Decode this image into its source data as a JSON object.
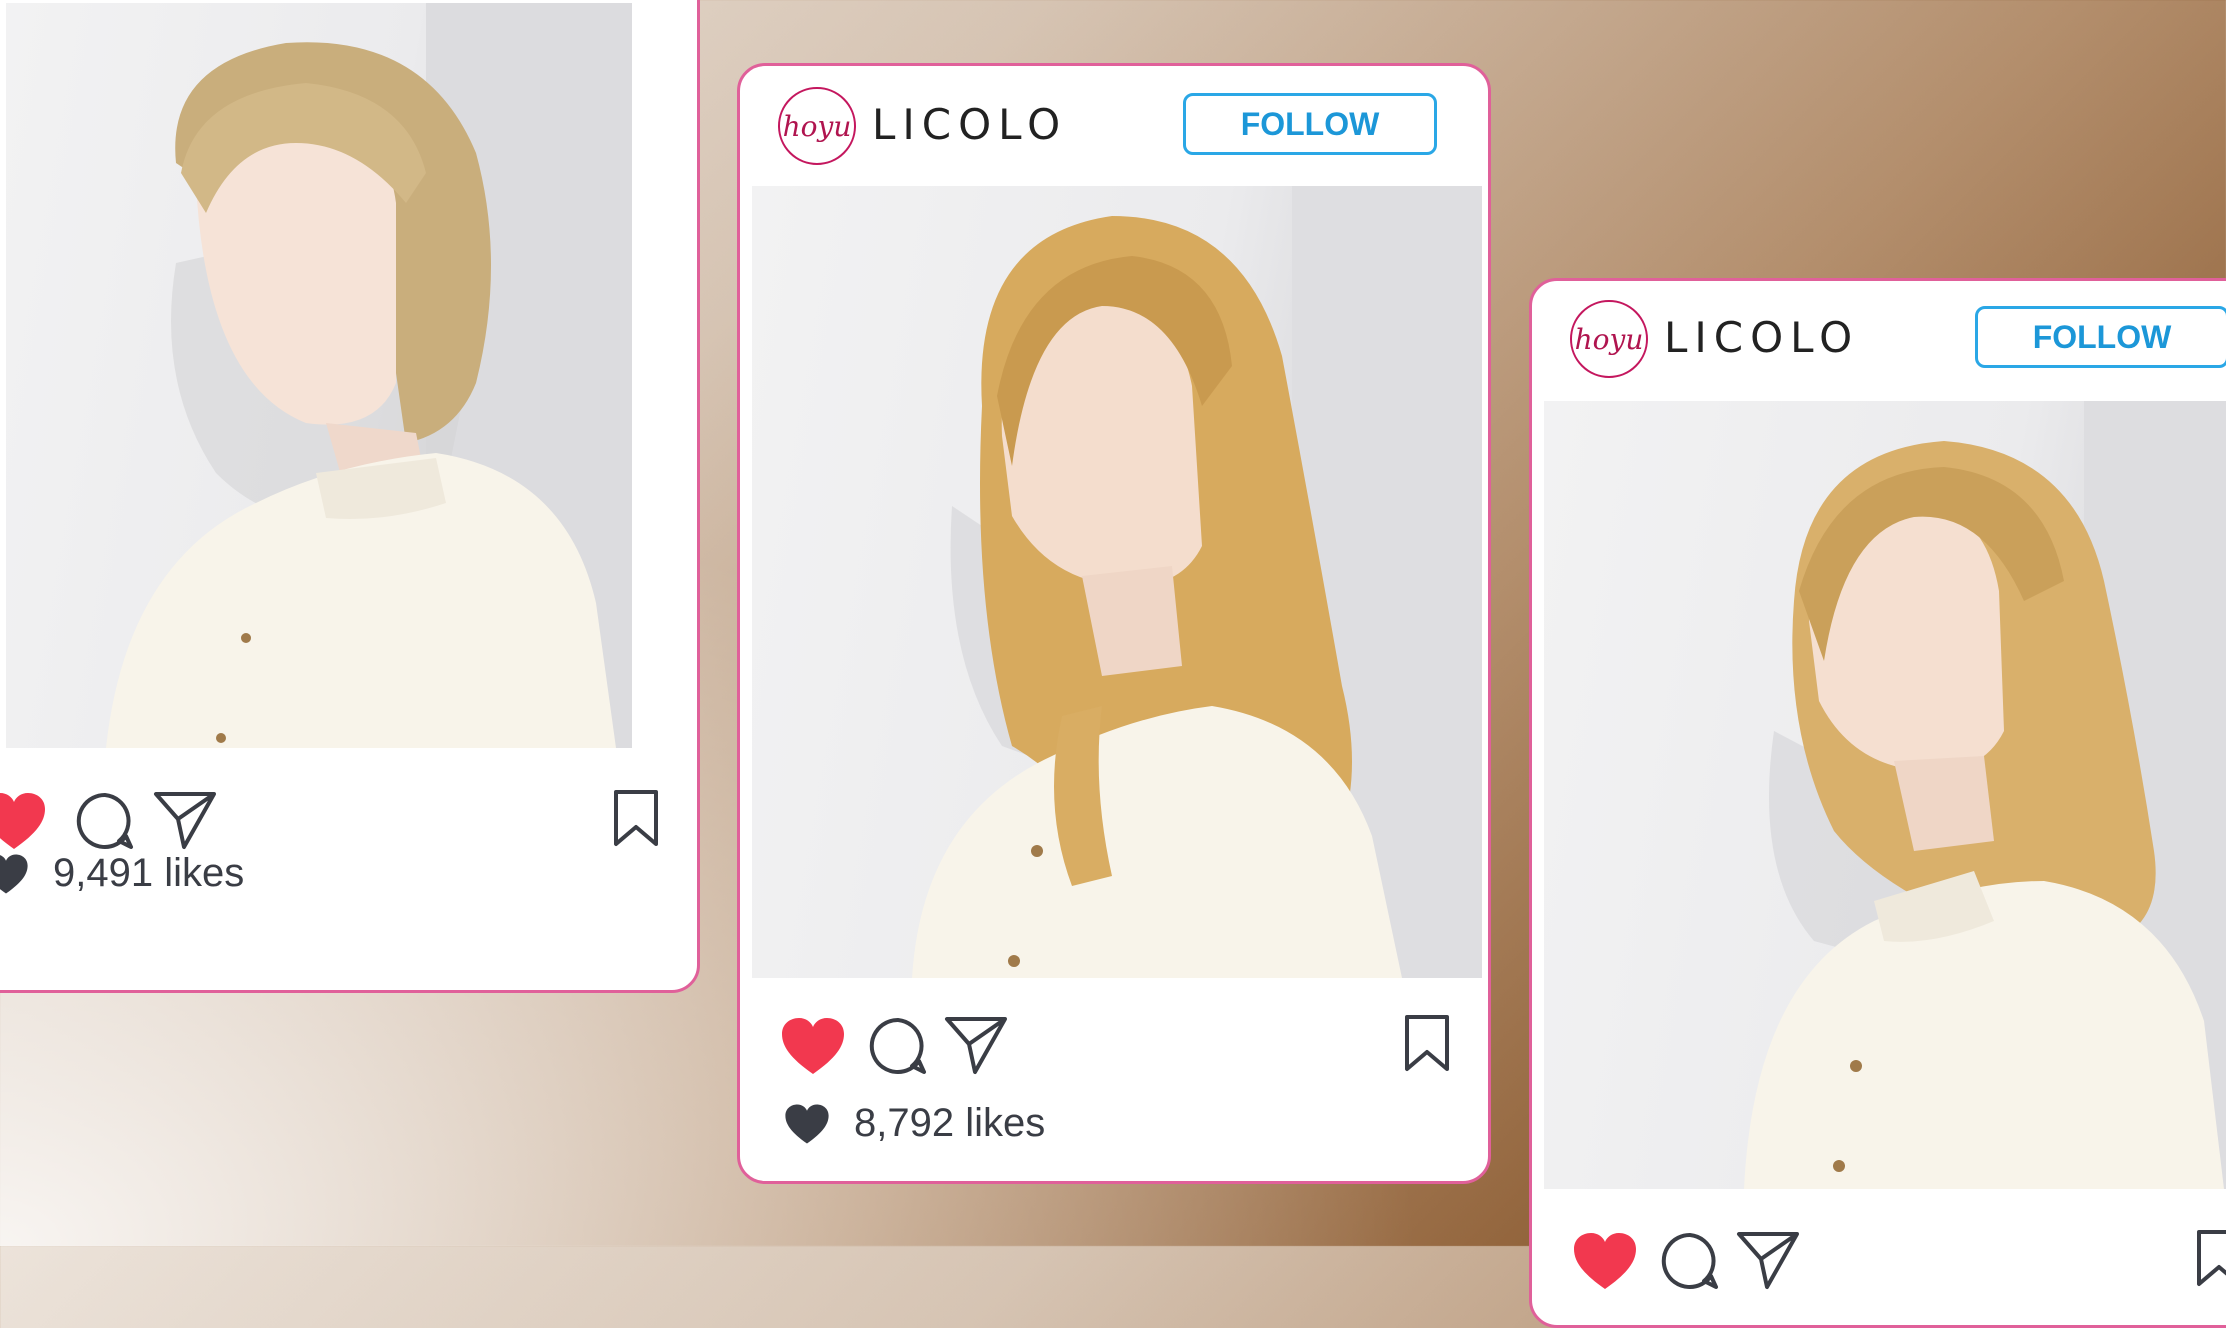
{
  "brand": {
    "logo_text": "hoyu",
    "name": "LICOLO"
  },
  "follow_label": "FOLLOW",
  "posts": [
    {
      "likes": "9,491 likes",
      "liked": true
    },
    {
      "likes": "8,792 likes",
      "liked": true
    },
    {
      "likes": "",
      "liked": true
    }
  ],
  "colors": {
    "card_border": "#e0609a",
    "follow_blue": "#2aa7e6",
    "heart_red": "#f2384f",
    "icon_dark": "#3a3d45",
    "logo_red": "#b0144f"
  },
  "icons": [
    "heart-icon",
    "comment-icon",
    "send-icon",
    "bookmark-icon",
    "likes-heart-icon"
  ]
}
